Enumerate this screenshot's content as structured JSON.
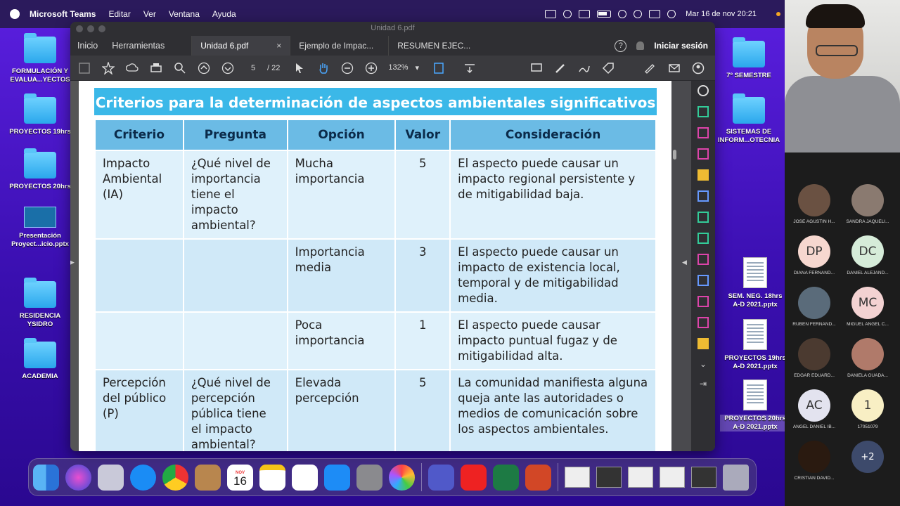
{
  "menubar": {
    "app_name": "Microsoft Teams",
    "menus": [
      "Editar",
      "Ver",
      "Ventana",
      "Ayuda"
    ],
    "datetime": "Mar 16 de nov  20:21"
  },
  "desktop_icons": {
    "left": [
      {
        "label": "FORMULACIÓN Y\nEVALUA...YECTOS",
        "kind": "folder"
      },
      {
        "label": "PROYECTOS 19hrs",
        "kind": "folder"
      },
      {
        "label": "PROYECTOS 20hrs",
        "kind": "folder"
      },
      {
        "label": "Presentación\nProyect...icio.pptx",
        "kind": "pptx"
      },
      {
        "label": "RESIDENCIA\nYSIDRO",
        "kind": "folder"
      },
      {
        "label": "ACADEMIA",
        "kind": "folder"
      }
    ],
    "right": [
      {
        "label": "7º SEMESTRE",
        "kind": "folder"
      },
      {
        "label": "SISTEMAS DE\nINFORM...OTECNIA",
        "kind": "folder"
      },
      {
        "label": "SEM. NEG. 18hrs\nA-D 2021.pptx",
        "kind": "doc"
      },
      {
        "label": "PROYECTOS 19hrs\nA-D 2021.pptx",
        "kind": "doc"
      },
      {
        "label": "PROYECTOS 20hrs\nA-D 2021.pptx",
        "kind": "doc"
      }
    ]
  },
  "window": {
    "title": "Unidad 6.pdf",
    "nav": {
      "home": "Inicio",
      "tools": "Herramientas"
    },
    "tabs": [
      {
        "label": "Unidad 6.pdf",
        "active": true,
        "close": "×"
      },
      {
        "label": "Ejemplo de Impac...",
        "active": false
      },
      {
        "label": "RESUMEN EJEC...",
        "active": false
      }
    ],
    "help": "?",
    "signin": "Iniciar sesión",
    "page_current": "5",
    "page_total": "/ 22",
    "zoom": "132%"
  },
  "pdf": {
    "heading": "Criterios para la determinación de aspectos ambientales significativos",
    "columns": [
      "Criterio",
      "Pregunta",
      "Opción",
      "Valor",
      "Consideración"
    ],
    "rows": [
      {
        "criterio": "Impacto Ambiental (IA)",
        "pregunta": "¿Qué nivel de importancia tiene el impacto ambiental?",
        "opcion": "Mucha importancia",
        "valor": "5",
        "consideracion": "El aspecto puede causar un impacto regional persistente y de mitigabilidad baja."
      },
      {
        "criterio": "",
        "pregunta": "",
        "opcion": "Importancia media",
        "valor": "3",
        "consideracion": "El aspecto puede causar un impacto de existencia local, temporal y de mitigabilidad media."
      },
      {
        "criterio": "",
        "pregunta": "",
        "opcion": "Poca importancia",
        "valor": "1",
        "consideracion": "El aspecto puede causar impacto puntual fugaz y de mitigabilidad alta."
      },
      {
        "criterio": "Percepción del público (P)",
        "pregunta": "¿Qué nivel de percepción pública tiene el impacto ambiental?",
        "opcion": "Elevada percepción",
        "valor": "5",
        "consideracion": "La comunidad manifiesta alguna queja ante las autoridades o medios de comunicación sobre los aspectos ambientales."
      }
    ]
  },
  "dock": {
    "calendar_month": "NOV",
    "calendar_day": "16"
  },
  "teams": {
    "participants": [
      {
        "initials": "",
        "name": "JOSE AGUSTIN H...",
        "color": "#6a5142"
      },
      {
        "initials": "",
        "name": "SANDRA JAQUELI...",
        "color": "#8a7a70"
      },
      {
        "initials": "DP",
        "name": "DIANA FERNAND...",
        "color": "#f6d7cf"
      },
      {
        "initials": "DC",
        "name": "DANIEL ALEJAND...",
        "color": "#d6ecd9"
      },
      {
        "initials": "",
        "name": "RUBEN FERNAND...",
        "color": "#5a6b7a"
      },
      {
        "initials": "MC",
        "name": "MIGUEL ANGEL C...",
        "color": "#f3d2d2"
      },
      {
        "initials": "",
        "name": "EDGAR EDUARD...",
        "color": "#4b3a30"
      },
      {
        "initials": "",
        "name": "DANIELA GUADA...",
        "color": "#b07a6a"
      },
      {
        "initials": "AC",
        "name": "ANGEL DANIEL IB...",
        "color": "#e3e3ef"
      },
      {
        "initials": "1",
        "name": "17051079",
        "color": "#f8efc4"
      },
      {
        "initials": "",
        "name": "CRISTIAN DAVID...",
        "color": "#2a1a10"
      },
      {
        "initials": "+2",
        "name": "",
        "color": "#3d4a6b"
      }
    ]
  }
}
